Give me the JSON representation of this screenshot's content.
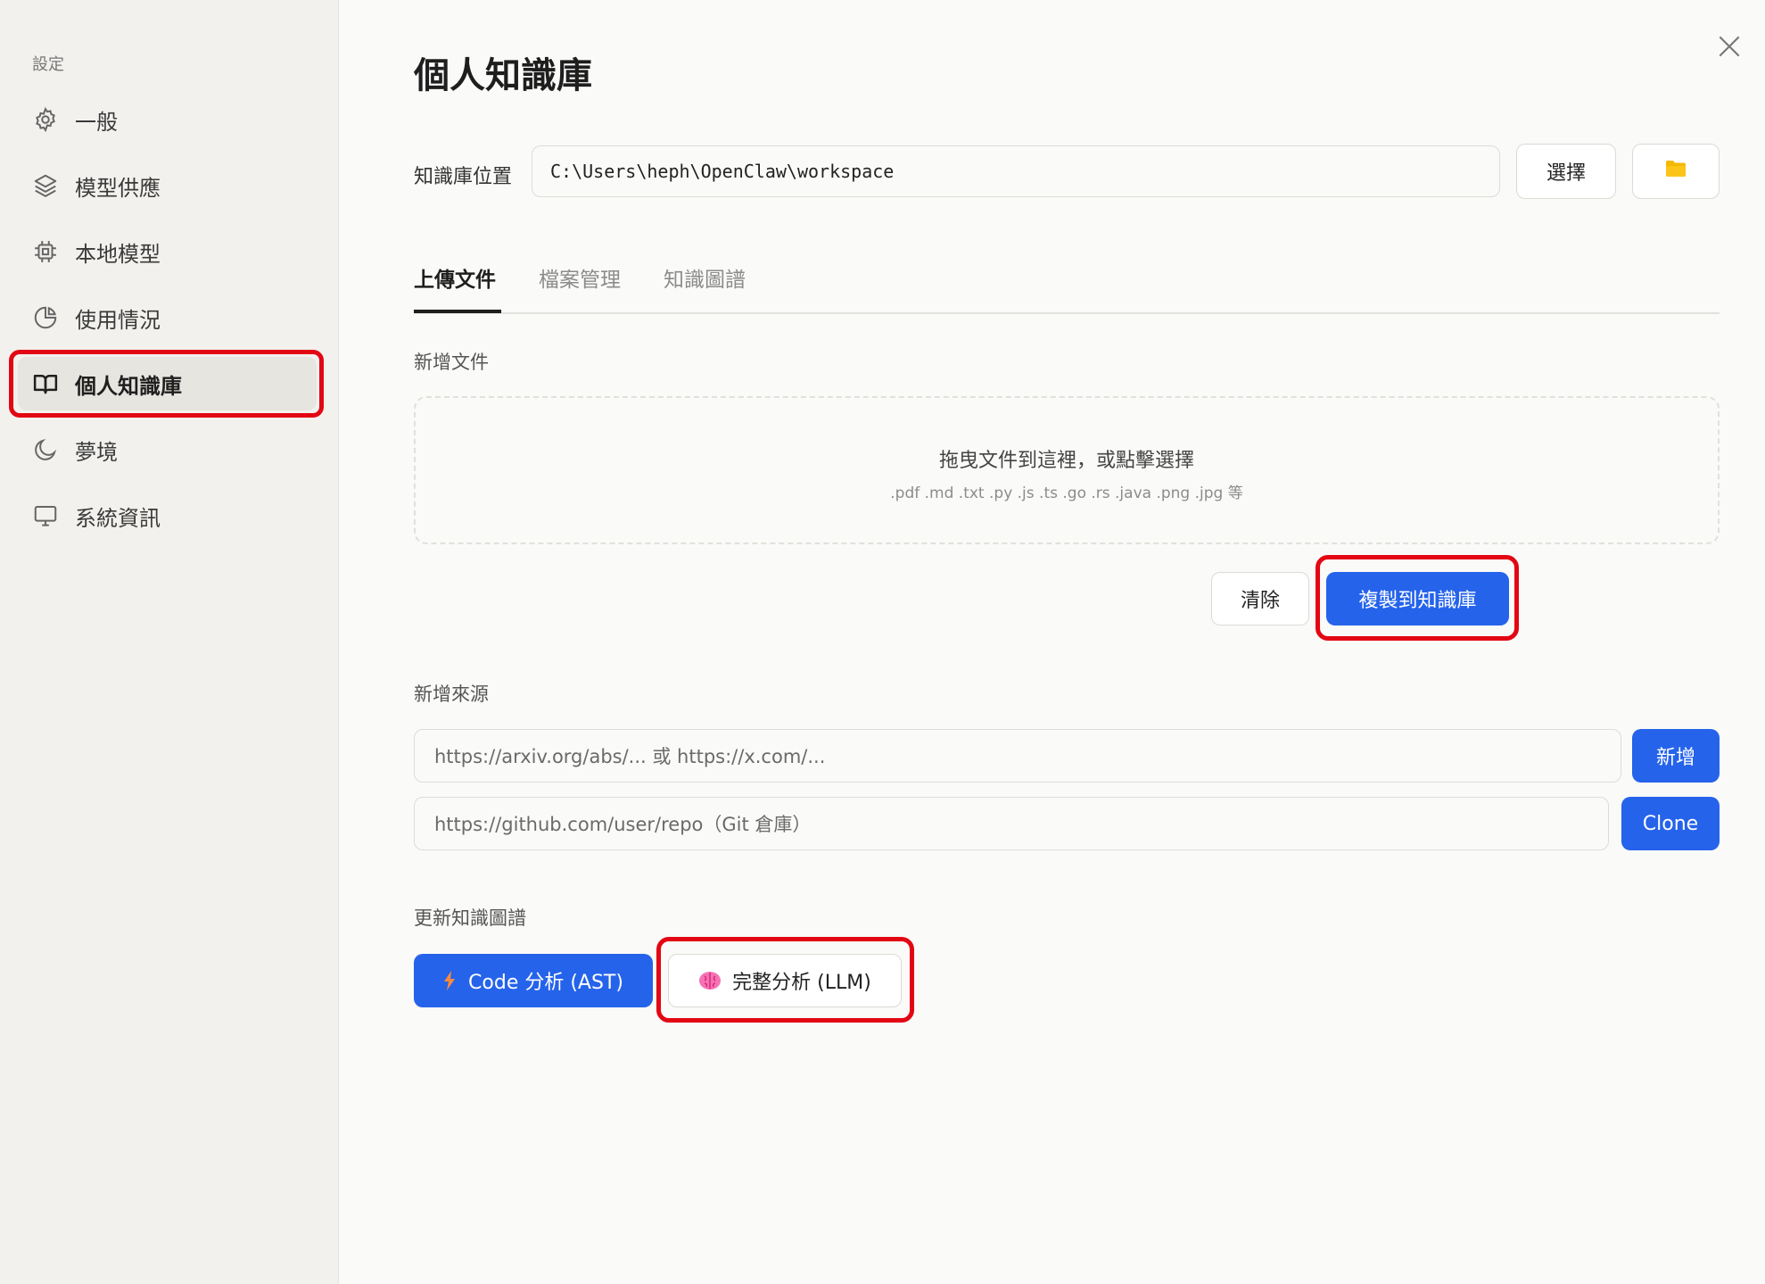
{
  "sidebar": {
    "heading": "設定",
    "items": [
      {
        "label": "一般",
        "icon": "gear-icon"
      },
      {
        "label": "模型供應",
        "icon": "layers-icon"
      },
      {
        "label": "本地模型",
        "icon": "chip-icon"
      },
      {
        "label": "使用情況",
        "icon": "pie-chart-icon"
      },
      {
        "label": "個人知識庫",
        "icon": "book-icon",
        "active": true
      },
      {
        "label": "夢境",
        "icon": "moon-icon"
      },
      {
        "label": "系統資訊",
        "icon": "monitor-icon"
      }
    ]
  },
  "main": {
    "title": "個人知識庫",
    "location": {
      "label": "知識庫位置",
      "value": "C:\\Users\\heph\\OpenClaw\\workspace",
      "choose_button": "選擇"
    },
    "tabs": [
      {
        "label": "上傳文件",
        "active": true
      },
      {
        "label": "檔案管理"
      },
      {
        "label": "知識圖譜"
      }
    ],
    "upload": {
      "section_label": "新增文件",
      "dropzone_title": "拖曳文件到這裡，或點擊選擇",
      "dropzone_types": ".pdf .md .txt .py .js .ts .go .rs .java .png .jpg 等",
      "clear_button": "清除",
      "copy_button": "複製到知識庫"
    },
    "source": {
      "section_label": "新增來源",
      "url_placeholder": "https://arxiv.org/abs/...  或  https://x.com/...",
      "add_button": "新增",
      "git_placeholder": "https://github.com/user/repo（Git 倉庫）",
      "clone_button": "Clone"
    },
    "graph": {
      "section_label": "更新知識圖譜",
      "ast_button": "Code 分析 (AST)",
      "llm_button": "完整分析 (LLM)"
    }
  },
  "colors": {
    "accent": "#2563eb",
    "highlight": "#e30613",
    "folder": "#f5b800"
  }
}
